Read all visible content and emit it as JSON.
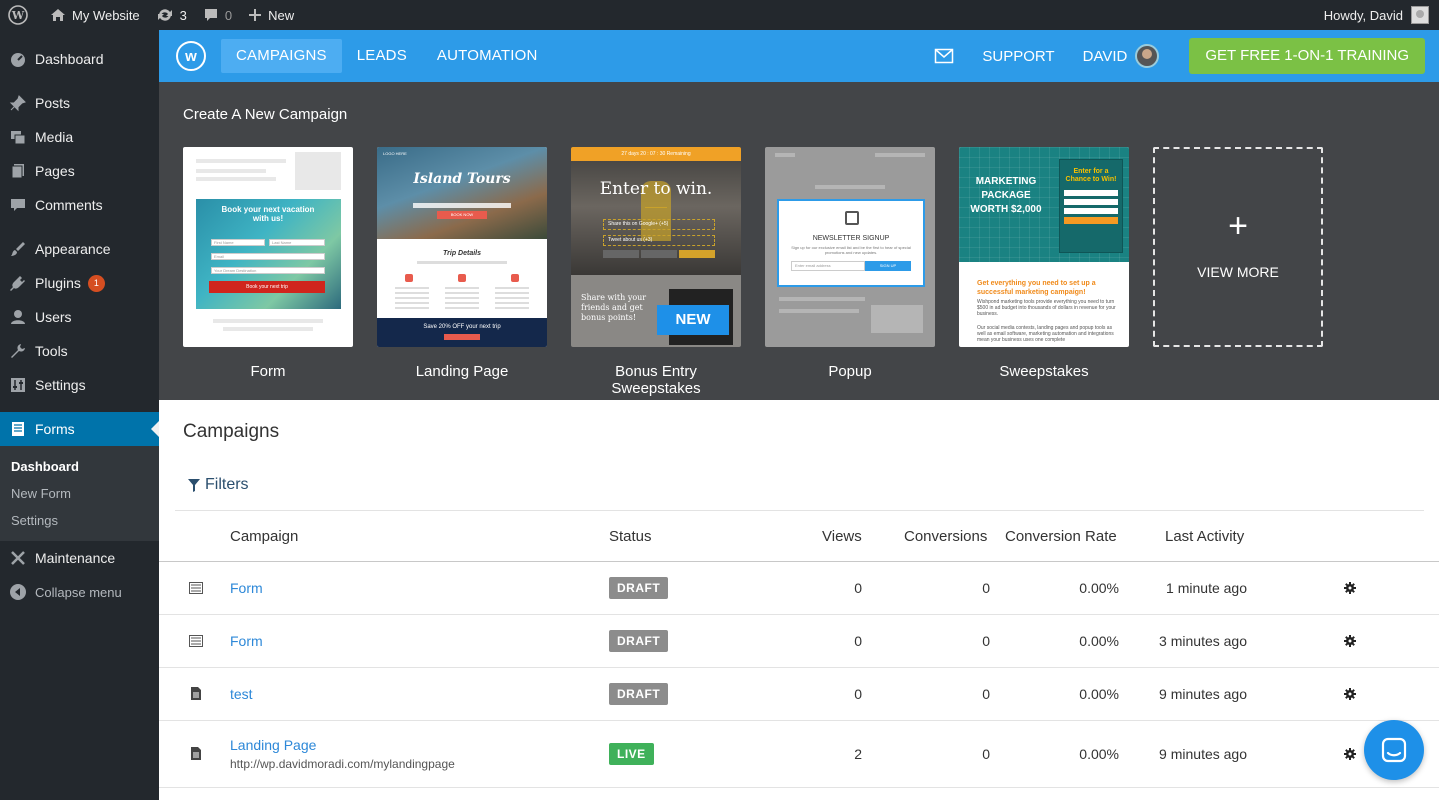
{
  "adminbar": {
    "site_name": "My Website",
    "updates_count": "3",
    "comments_count": "0",
    "new_label": "New",
    "howdy": "Howdy, David"
  },
  "sidebar": {
    "items": [
      {
        "label": "Dashboard",
        "icon": "dashboard-icon"
      },
      {
        "label": "Posts",
        "icon": "pin-icon"
      },
      {
        "label": "Media",
        "icon": "media-icon"
      },
      {
        "label": "Pages",
        "icon": "pages-icon"
      },
      {
        "label": "Comments",
        "icon": "comment-icon"
      },
      {
        "label": "Appearance",
        "icon": "brush-icon"
      },
      {
        "label": "Plugins",
        "icon": "plug-icon",
        "badge": "1"
      },
      {
        "label": "Users",
        "icon": "user-icon"
      },
      {
        "label": "Tools",
        "icon": "wrench-icon"
      },
      {
        "label": "Settings",
        "icon": "sliders-icon"
      },
      {
        "label": "Forms",
        "icon": "form-icon"
      },
      {
        "label": "Maintenance",
        "icon": "tools-icon"
      },
      {
        "label": "Collapse menu",
        "icon": "collapse-icon"
      }
    ],
    "submenu": [
      "Dashboard",
      "New Form",
      "Settings"
    ]
  },
  "topnav": {
    "logo": "w",
    "tabs": [
      "CAMPAIGNS",
      "LEADS",
      "AUTOMATION"
    ],
    "support": "SUPPORT",
    "user": "DAVID",
    "cta": "GET FREE 1-ON-1 TRAINING"
  },
  "create": {
    "heading": "Create A New Campaign",
    "templates": [
      {
        "label": "Form",
        "thumb": {
          "title": "Book your next vacation with us!",
          "field1": "First Name",
          "field2": "Last Name",
          "field3": "Email",
          "field4": "Your Dream Destination",
          "button": "Book your next trip"
        }
      },
      {
        "label": "Landing Page",
        "thumb": {
          "logo": "LOGO HERE",
          "title": "Island Tours",
          "button": "BOOK NOW",
          "section": "Trip Details",
          "footer": "Save 20% OFF your next trip"
        }
      },
      {
        "label": "Bonus Entry Sweepstakes",
        "thumb": {
          "timer": "27 days 20 : 07 : 30  Remaining",
          "title": "Enter to win.",
          "row1": "Share this on Google+ (+5)",
          "row2": "Tweet about us (+3)",
          "lower": "Share with your friends and get bonus points!",
          "badge": "NEW"
        }
      },
      {
        "label": "Popup",
        "thumb": {
          "title": "NEWSLETTER SIGNUP",
          "subtitle": "Sign up for our exclusive email list and be the first to hear of special promotions and new updates.",
          "input": "Enter email address",
          "button": "SIGN UP"
        }
      },
      {
        "label": "Sweepstakes",
        "thumb": {
          "headline": "MARKETING PACKAGE WORTH $2,000",
          "form_title": "Enter for a Chance to Win!",
          "orange": "Get everything you need to set up a successful marketing campaign!",
          "p1": "Wishpond marketing tools provide everything you need to turn $500 in ad budget into thousands of dollars in revenue for your business.",
          "p2": "Our social media contests, landing pages and popup tools as well as email software, marketing automation and integrations mean your business uses one complete"
        }
      },
      {
        "label": "VIEW MORE"
      }
    ]
  },
  "campaigns": {
    "title": "Campaigns",
    "filters": "Filters",
    "columns": [
      "Campaign",
      "Status",
      "Views",
      "Conversions",
      "Conversion Rate",
      "Last Activity"
    ],
    "rows": [
      {
        "icon": "form-row-icon",
        "name": "Form",
        "url": "",
        "status": "DRAFT",
        "views": "0",
        "conversions": "0",
        "rate": "0.00%",
        "activity": "1 minute ago"
      },
      {
        "icon": "form-row-icon",
        "name": "Form",
        "url": "",
        "status": "DRAFT",
        "views": "0",
        "conversions": "0",
        "rate": "0.00%",
        "activity": "3 minutes ago"
      },
      {
        "icon": "page-row-icon",
        "name": "test",
        "url": "",
        "status": "DRAFT",
        "views": "0",
        "conversions": "0",
        "rate": "0.00%",
        "activity": "9 minutes ago"
      },
      {
        "icon": "page-row-icon",
        "name": "Landing Page",
        "url": "http://wp.davidmoradi.com/mylandingpage",
        "status": "LIVE",
        "views": "2",
        "conversions": "0",
        "rate": "0.00%",
        "activity": "9 minutes ago"
      }
    ]
  },
  "colors": {
    "accent_blue": "#2d9be8",
    "cta_green": "#7bc145",
    "wp_dark": "#23282d",
    "wp_active": "#0073aa",
    "draft": "#8c8c8c",
    "live": "#3fb15a"
  }
}
